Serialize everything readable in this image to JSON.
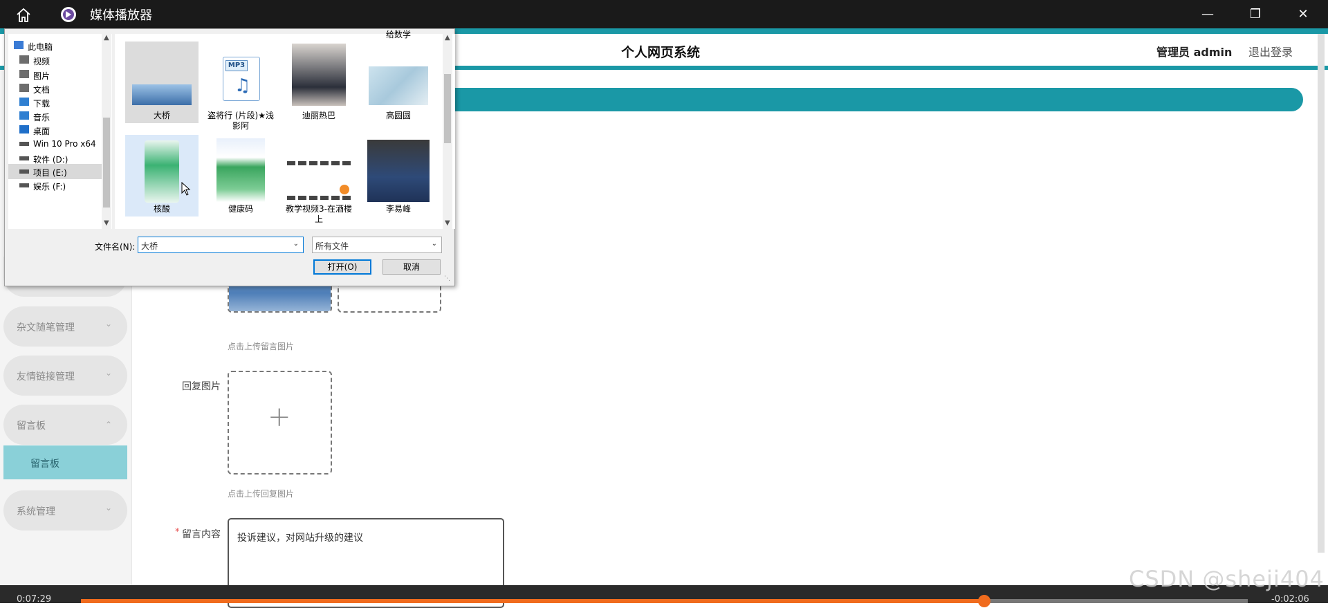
{
  "player": {
    "title": "媒体播放器",
    "time_elapsed": "0:07:29",
    "time_remaining": "-0:02:06",
    "progress_fraction": 0.775
  },
  "header": {
    "title": "个人网页系统",
    "admin": "管理员 admin",
    "logout": "退出登录"
  },
  "sidebar": {
    "menu": [
      {
        "label": "杂文随笔管理"
      },
      {
        "label": "友情链接管理"
      },
      {
        "label": "留言板"
      },
      {
        "label": "系统管理"
      }
    ],
    "selected": "留言板"
  },
  "form": {
    "upload_hint_message": "点击上传留言图片",
    "reply_label": "回复图片",
    "upload_hint_reply": "点击上传回复图片",
    "required_mark": "*",
    "content_label": "留言内容",
    "content_value": "投诉建议，对网站升级的建议"
  },
  "dialog": {
    "nav": [
      {
        "label": "此电脑",
        "icon": "computer-icon"
      },
      {
        "label": "视频",
        "icon": "video-folder-icon"
      },
      {
        "label": "图片",
        "icon": "pictures-folder-icon"
      },
      {
        "label": "文档",
        "icon": "documents-folder-icon"
      },
      {
        "label": "下载",
        "icon": "download-icon"
      },
      {
        "label": "音乐",
        "icon": "music-icon"
      },
      {
        "label": "桌面",
        "icon": "desktop-icon"
      },
      {
        "label": "Win 10 Pro x64",
        "icon": "drive-icon"
      },
      {
        "label": "软件 (D:)",
        "icon": "drive-icon"
      },
      {
        "label": "项目 (E:)",
        "icon": "drive-icon"
      },
      {
        "label": "娱乐 (F:)",
        "icon": "drive-icon"
      }
    ],
    "partial_top_caption": "给数学",
    "files": [
      {
        "name": "大桥"
      },
      {
        "name": "盗将行 (片段)★浅影阿"
      },
      {
        "name": "迪丽热巴"
      },
      {
        "name": "高圆圆"
      },
      {
        "name": "核酸"
      },
      {
        "name": "健康码"
      },
      {
        "name": "教学视频3-在酒楼上"
      },
      {
        "name": "李易峰"
      }
    ],
    "mp3_badge": "MP3",
    "filename_label": "文件名(N):",
    "filename_value": "大桥",
    "filetype_value": "所有文件",
    "open_button": "打开(O)",
    "cancel_button": "取消"
  },
  "watermark": "CSDN @sheji404"
}
